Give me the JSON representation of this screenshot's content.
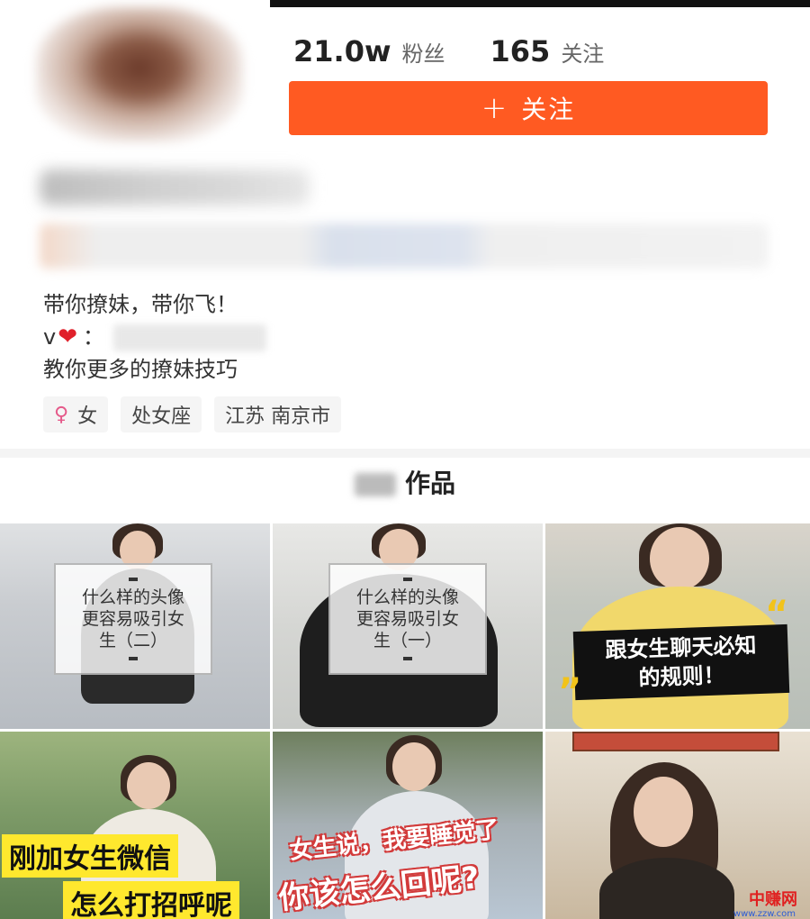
{
  "profile": {
    "fans_count": "21.0w",
    "fans_label": "粉丝",
    "following_count": "165",
    "following_label": "关注",
    "follow_button": "关注",
    "follow_icon": "plus-icon",
    "bio_lines": [
      "带你撩妹，带你飞！",
      "v",
      "教你更多的撩妹技巧"
    ],
    "bio_colon": "：",
    "tags": {
      "gender": "女",
      "gender_icon": "female-icon",
      "zodiac": "处女座",
      "location": "江苏 南京市"
    }
  },
  "works": {
    "label": "作品",
    "items": [
      {
        "caption_lines": [
          "什么样的头像",
          "更容易吸引女",
          "生（二）"
        ]
      },
      {
        "caption_lines": [
          "什么样的头像",
          "更容易吸引女",
          "生（一）"
        ]
      },
      {
        "caption_lines": [
          "跟女生聊天必知",
          "的规则！"
        ]
      },
      {
        "caption_lines": [
          "刚加女生微信",
          "怎么打招呼呢"
        ]
      },
      {
        "caption_lines": [
          "女生说，我要睡觉了",
          "你该怎么回呢?"
        ]
      },
      {
        "caption_lines": []
      }
    ]
  },
  "watermark": {
    "text": "中赚网",
    "sub": "www.zzw.com"
  },
  "colors": {
    "accent": "#ff5a22",
    "yellow": "#ffe82e"
  }
}
